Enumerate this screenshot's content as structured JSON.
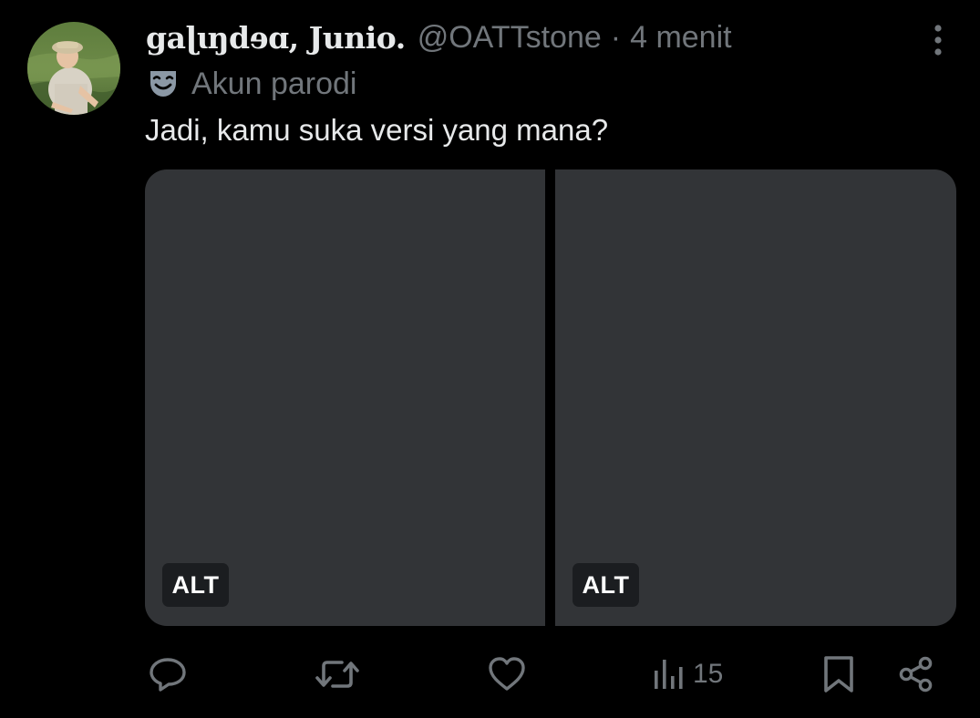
{
  "tweet": {
    "display_name": "gaɭɩŋdɘɑ, Junio.",
    "handle": "@OATTstone",
    "separator": "·",
    "time": "4 menit",
    "parody_label": "Akun parodi",
    "text": "Jadi, kamu suka versi yang mana?"
  },
  "media": [
    {
      "alt_label": "ALT"
    },
    {
      "alt_label": "ALT"
    }
  ],
  "actions": {
    "reply_icon": "reply-icon",
    "retweet_icon": "retweet-icon",
    "like_icon": "heart-icon",
    "views_icon": "views-chart-icon",
    "views_count": "15",
    "bookmark_icon": "bookmark-icon",
    "share_icon": "share-icon"
  },
  "colors": {
    "background": "#000000",
    "text_primary": "#e7e9ea",
    "text_secondary": "#71767b",
    "media_placeholder": "#323437",
    "alt_badge_bg": "#1b1d20"
  }
}
